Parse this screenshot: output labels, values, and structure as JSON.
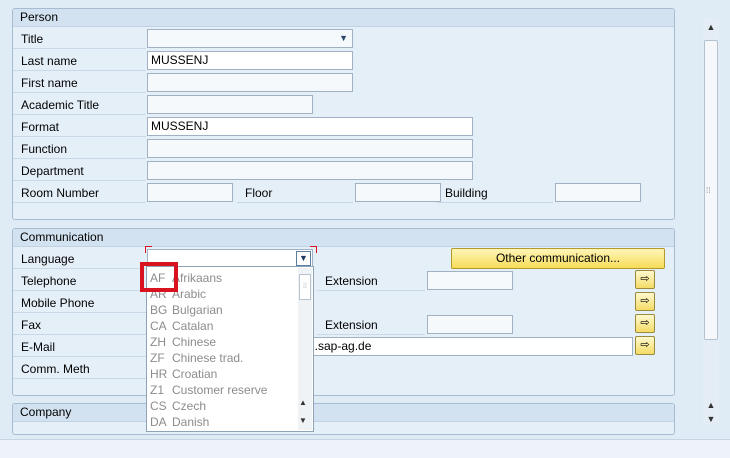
{
  "person": {
    "title": "Person",
    "labels": {
      "title": "Title",
      "last_name": "Last name",
      "first_name": "First name",
      "academic_title": "Academic Title",
      "format": "Format",
      "function": "Function",
      "department": "Department",
      "room_number": "Room Number",
      "floor": "Floor",
      "building": "Building"
    },
    "values": {
      "title": "",
      "last_name": "MUSSENJ",
      "first_name": "",
      "academic_title": "",
      "format": "MUSSENJ",
      "function": "",
      "department": "",
      "room_number": "",
      "floor": "",
      "building": ""
    }
  },
  "communication": {
    "title": "Communication",
    "labels": {
      "language": "Language",
      "telephone": "Telephone",
      "mobile_phone": "Mobile Phone",
      "fax": "Fax",
      "email": "E-Mail",
      "comm_meth": "Comm. Meth",
      "extension_1": "Extension",
      "extension_2": "Extension"
    },
    "values": {
      "email_visible": "l.sap-ag.de"
    },
    "other_communication_button": "Other communication...",
    "arrow_glyph": "⇨"
  },
  "company": {
    "title": "Company"
  },
  "language_dropdown": {
    "items": [
      {
        "code": "AF",
        "name": "Afrikaans"
      },
      {
        "code": "AR",
        "name": "Arabic"
      },
      {
        "code": "BG",
        "name": "Bulgarian"
      },
      {
        "code": "CA",
        "name": "Catalan"
      },
      {
        "code": "ZH",
        "name": "Chinese"
      },
      {
        "code": "ZF",
        "name": "Chinese trad."
      },
      {
        "code": "HR",
        "name": "Croatian"
      },
      {
        "code": "Z1",
        "name": "Customer reserve"
      },
      {
        "code": "CS",
        "name": "Czech"
      },
      {
        "code": "DA",
        "name": "Danish"
      }
    ]
  },
  "colors": {
    "highlight_box": "#d8121e",
    "button_yellow": "#f7dc5a",
    "group_bg": "#e5eff8"
  }
}
